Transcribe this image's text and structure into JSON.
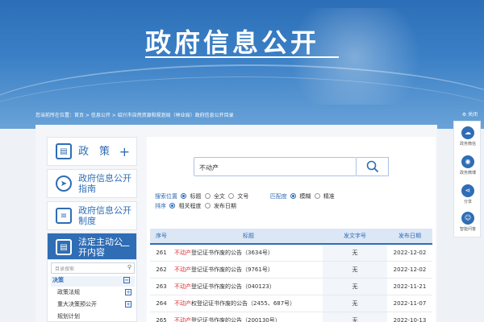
{
  "banner": {
    "title": "政府信息公开"
  },
  "breadcrumb": {
    "text": "您当前所在位置：首页 > 信息公开 > 绍兴市自然资源和规划局（林业局）政府信息公开目录"
  },
  "close_label": "关闭",
  "nav": [
    {
      "label": "政　策",
      "icon": "calendar-icon",
      "expand": "+"
    },
    {
      "label": "政府信息公开指南",
      "icon": "compass-icon",
      "expand": ""
    },
    {
      "label": "政府信息公开制度",
      "icon": "list-doc-icon",
      "expand": ""
    },
    {
      "label": "法定主动公开内容",
      "icon": "calendar-icon",
      "expand": "—"
    }
  ],
  "tree": {
    "search_placeholder": "目录搜索",
    "items": [
      {
        "label": "决策",
        "toggle": "−"
      },
      {
        "label": "政策法规",
        "toggle": "+"
      },
      {
        "label": "重大决策预公开",
        "toggle": "+"
      },
      {
        "label": "规划计划",
        "toggle": ""
      }
    ]
  },
  "search": {
    "value": "不动产",
    "position_label": "搜索位置",
    "positions": [
      "标题",
      "全文",
      "文号"
    ],
    "match_label": "匹配度",
    "matches": [
      "模糊",
      "精准"
    ],
    "sort_label": "排序",
    "sorts": [
      "相关程度",
      "发布日期"
    ]
  },
  "table": {
    "headers": [
      "序号",
      "标题",
      "发文字号",
      "发布日期"
    ],
    "rows": [
      {
        "no": "261",
        "hl": "不动产",
        "title": "登记证书作废的公告（3634号）",
        "doc": "无",
        "date": "2022-12-02"
      },
      {
        "no": "262",
        "hl": "不动产",
        "title": "登记证书作废的公告（9761号）",
        "doc": "无",
        "date": "2022-12-02"
      },
      {
        "no": "263",
        "hl": "不动产",
        "title": "登记证书作废的公告（040123）",
        "doc": "无",
        "date": "2022-11-21"
      },
      {
        "no": "264",
        "hl": "不动产",
        "title": "权登记证书作废的公告（2455、687号）",
        "doc": "无",
        "date": "2022-11-07"
      },
      {
        "no": "265",
        "hl": "不动产",
        "title": "登记证书作废的公告（200130号）",
        "doc": "无",
        "date": "2022-10-13"
      }
    ]
  },
  "sidebar": [
    {
      "label": "政务微信",
      "icon": "wechat-icon"
    },
    {
      "label": "政务微博",
      "icon": "weibo-icon"
    },
    {
      "label": "分享",
      "icon": "share-icon"
    },
    {
      "label": "智能问答",
      "icon": "robot-icon"
    }
  ]
}
